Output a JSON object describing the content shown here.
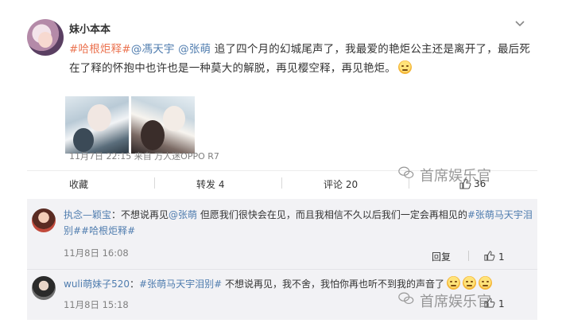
{
  "post": {
    "username": "妹小本本",
    "tag1": "#哈根炬释#",
    "mention1": "@馮天宇",
    "mention2": "@张萌",
    "text": " 追了四个月的幻城尾声了，我最爱的艳炬公主还是离开了，最后死在了释的怀抱中也许也是一种莫大的解脱，再见樱空释，再见艳炬。",
    "meta": "11月7日 22:15 来自 万人迷OPPO R7"
  },
  "actions": {
    "collect": "收藏",
    "repost": "转发 4",
    "comment": "评论 20",
    "like_count": "36"
  },
  "watermark": "首席娱乐官",
  "comments": [
    {
      "name": "执念—颖宝",
      "text": "：不想说再见",
      "mention": "@张萌",
      "text2": " 但愿我们很快会在见，而且我相信不久以后我们一定会再相见的",
      "tag": "#张萌马天宇泪别##哈根炬释#",
      "time": "11月8日 16:08",
      "reply": "回复",
      "likes": "1"
    },
    {
      "name": "wuli萌妹子520",
      "tag": "#张萌马天宇泪别#",
      "text": " 不想说再见，我不舍，我怕你再也听不到我的声音了",
      "time": "11月8日 15:18",
      "likes": "1"
    }
  ],
  "colors": {
    "tag": "#eb7350",
    "link": "#507daf",
    "meta": "#808080",
    "comment_bg": "#f2f2f5"
  },
  "icons": [
    "chevron-down-icon",
    "thumbs-up-icon",
    "wechat-watermark-icon",
    "sad-emoji-icon"
  ]
}
